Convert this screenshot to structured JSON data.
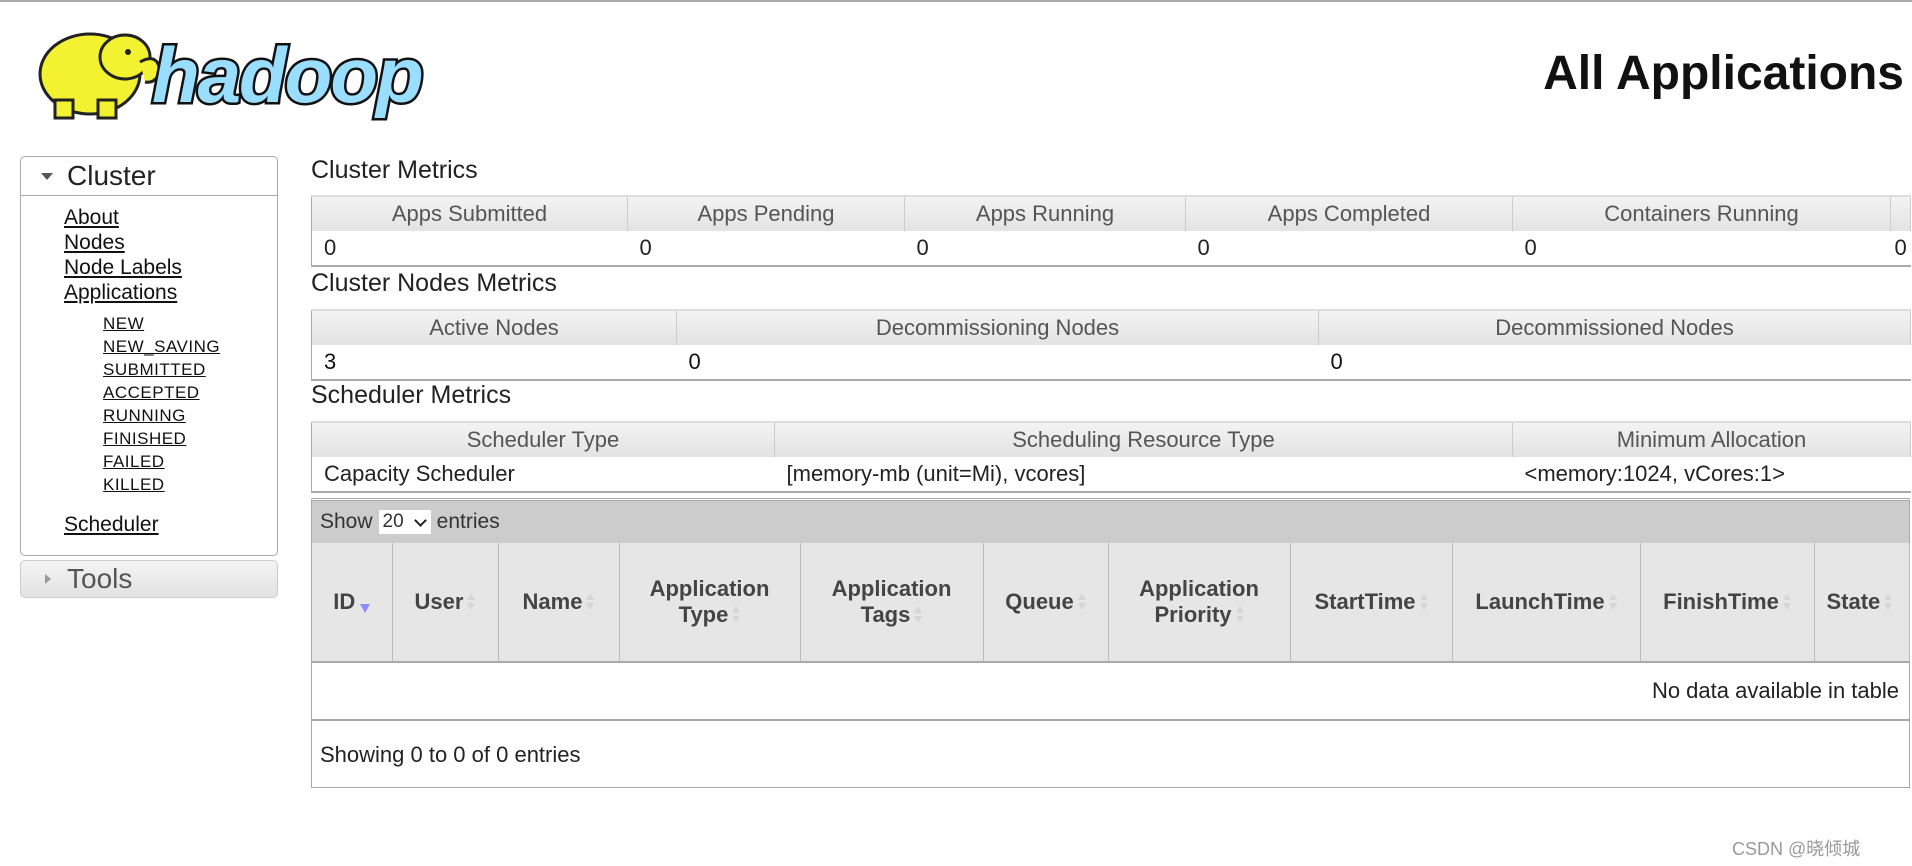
{
  "header": {
    "logo_text": "hadoop",
    "page_title": "All Applications"
  },
  "sidebar": {
    "cluster_label": "Cluster",
    "links": [
      "About",
      "Nodes",
      "Node Labels",
      "Applications"
    ],
    "app_states": [
      "NEW",
      "NEW_SAVING",
      "SUBMITTED",
      "ACCEPTED",
      "RUNNING",
      "FINISHED",
      "FAILED",
      "KILLED"
    ],
    "scheduler_link": "Scheduler",
    "tools_label": "Tools"
  },
  "cluster_metrics": {
    "title": "Cluster Metrics",
    "headers": [
      "Apps Submitted",
      "Apps Pending",
      "Apps Running",
      "Apps Completed",
      "Containers Running",
      ""
    ],
    "values": [
      "0",
      "0",
      "0",
      "0",
      "0",
      "0"
    ]
  },
  "nodes_metrics": {
    "title": "Cluster Nodes Metrics",
    "headers": [
      "Active Nodes",
      "Decommissioning Nodes",
      "Decommissioned Nodes"
    ],
    "values": [
      "3",
      "0",
      "0"
    ]
  },
  "scheduler_metrics": {
    "title": "Scheduler Metrics",
    "headers": [
      "Scheduler Type",
      "Scheduling Resource Type",
      "Minimum Allocation"
    ],
    "values": [
      "Capacity Scheduler",
      "[memory-mb (unit=Mi), vcores]",
      "<memory:1024, vCores:1>"
    ]
  },
  "apps_table": {
    "show_label": "Show",
    "page_size": "20",
    "entries_label": "entries",
    "columns": [
      "ID",
      "User",
      "Name",
      "Application Type",
      "Application Tags",
      "Queue",
      "Application Priority",
      "StartTime",
      "LaunchTime",
      "FinishTime",
      "State"
    ],
    "sorted_column": "ID",
    "sort_direction": "descending",
    "sort_color": "#8c8cff",
    "empty_message": "No data available in table",
    "info": "Showing 0 to 0 of 0 entries"
  },
  "watermark": "CSDN @晓倾城"
}
